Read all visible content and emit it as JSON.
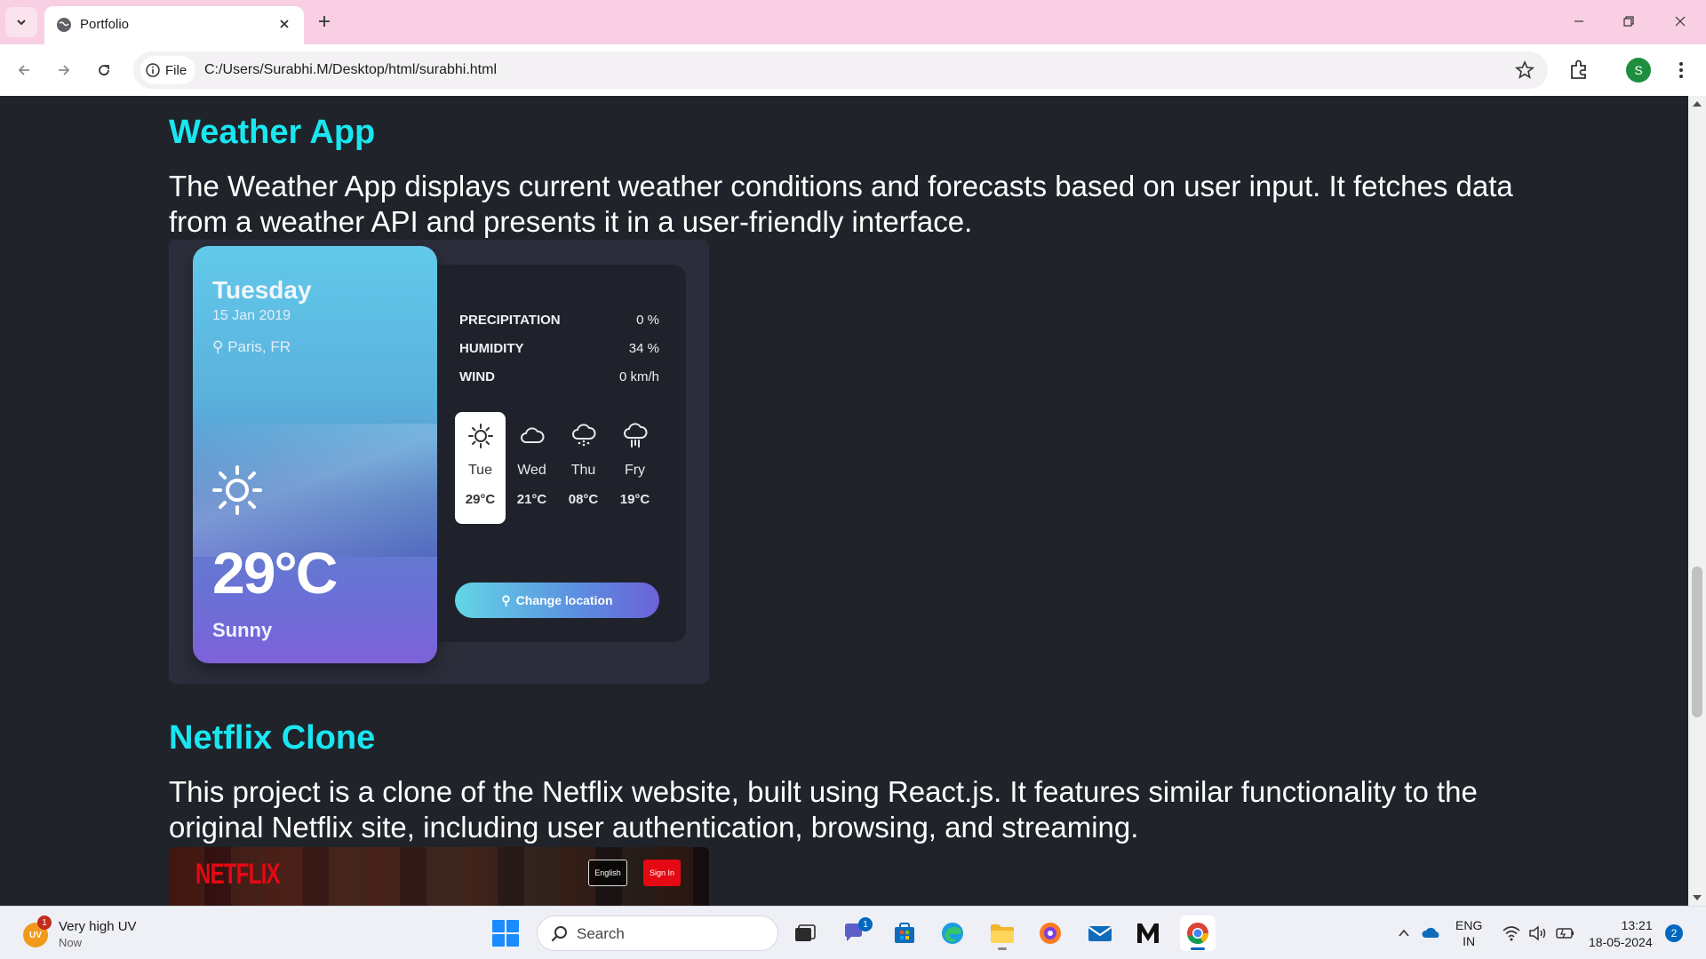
{
  "browser": {
    "tab_title": "Portfolio",
    "chip_label": "File",
    "url": "C:/Users/Surabhi.M/Desktop/html/surabhi.html",
    "profile_initial": "S"
  },
  "projects": [
    {
      "title": "Weather App",
      "description": "The Weather App displays current weather conditions and forecasts based on user input. It fetches data from a weather API and presents it in a user-friendly interface."
    },
    {
      "title": "Netflix Clone",
      "description": "This project is a clone of the Netflix website, built using React.js. It features similar functionality to the original Netflix site, including user authentication, browsing, and streaming."
    }
  ],
  "weather_preview": {
    "day": "Tuesday",
    "date": "15 Jan 2019",
    "location": "Paris, FR",
    "temperature": "29°C",
    "condition": "Sunny",
    "stats": [
      {
        "label": "PRECIPITATION",
        "value": "0 %"
      },
      {
        "label": "HUMIDITY",
        "value": "34 %"
      },
      {
        "label": "WIND",
        "value": "0 km/h"
      }
    ],
    "forecast": [
      {
        "day": "Tue",
        "temp": "29°C",
        "icon": "sun-icon"
      },
      {
        "day": "Wed",
        "temp": "21°C",
        "icon": "cloud-icon"
      },
      {
        "day": "Thu",
        "temp": "08°C",
        "icon": "snow-cloud-icon"
      },
      {
        "day": "Fry",
        "temp": "19°C",
        "icon": "rain-cloud-icon"
      }
    ],
    "button": "Change location"
  },
  "netflix_preview": {
    "logo": "NETFLIX",
    "language": "English",
    "sign_in": "Sign In"
  },
  "taskbar": {
    "weather_title": "Very high UV",
    "weather_sub": "Now",
    "weather_badge": "UV",
    "weather_count": "1",
    "search_label": "Search",
    "teams_badge": "1",
    "lang_line1": "ENG",
    "lang_line2": "IN",
    "time": "13:21",
    "date": "18-05-2024",
    "notification_count": "2"
  },
  "colors": {
    "page_bg": "#20232a",
    "accent_title": "#19e6f0",
    "tabbar": "#f8cfe3"
  }
}
